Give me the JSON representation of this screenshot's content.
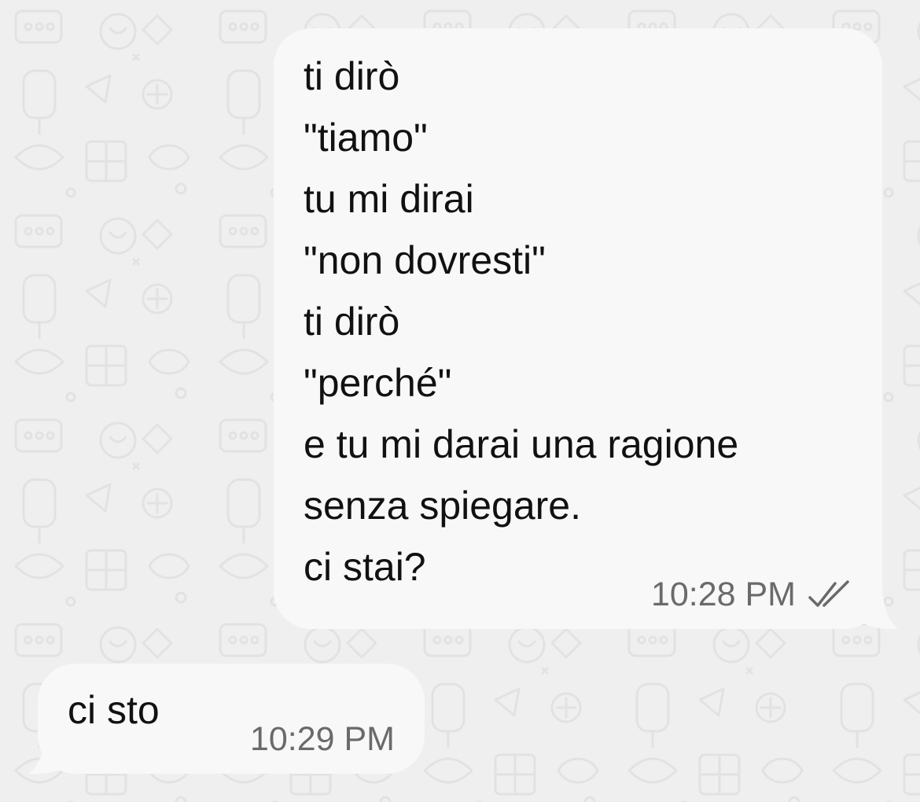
{
  "chat": {
    "messages": [
      {
        "direction": "outgoing",
        "lines": [
          "ti dirò",
          "\"tiamo\"",
          "tu mi dirai",
          "\"non dovresti\"",
          "ti dirò",
          "\"perché\"",
          "e tu mi darai una ragione",
          "senza spiegare.",
          "ci stai?"
        ],
        "time": "10:28 PM",
        "status_icon": "double-check-icon"
      },
      {
        "direction": "incoming",
        "text": "ci sto",
        "time": "10:29 PM"
      }
    ]
  },
  "colors": {
    "wallpaper": "#efefef",
    "bubble": "#f8f8f8",
    "message_text": "#111111",
    "meta_text": "#6a6a6a"
  }
}
